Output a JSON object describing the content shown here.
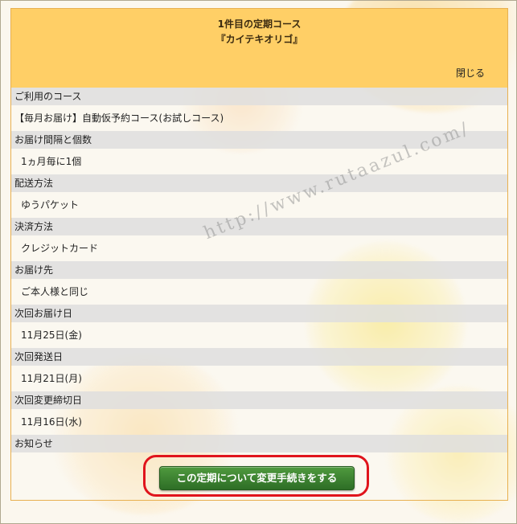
{
  "course": {
    "title_line1": "1件目の定期コース",
    "title_line2": "『カイテキオリゴ』",
    "close_label": "閉じる"
  },
  "watermark": "http://www.rutaazul.com/",
  "details": [
    {
      "label": "ご利用のコース",
      "value": "【毎月お届け】自動仮予約コース(お試しコース)"
    },
    {
      "label": "お届け間隔と個数",
      "value": "1ヵ月毎に1個"
    },
    {
      "label": "配送方法",
      "value": "ゆうパケット"
    },
    {
      "label": "決済方法",
      "value": "クレジットカード"
    },
    {
      "label": "お届け先",
      "value": "ご本人様と同じ"
    },
    {
      "label": "次回お届け日",
      "value": "11月25日(金)"
    },
    {
      "label": "次回発送日",
      "value": "11月21日(月)"
    },
    {
      "label": "次回変更締切日",
      "value": "11月16日(水)"
    },
    {
      "label": "お知らせ",
      "value": ""
    }
  ],
  "action": {
    "label": "この定期について変更手続きをする"
  },
  "colors": {
    "header": "#ffcf66",
    "label_row": "#dedede",
    "button": "#3d8431",
    "highlight": "#e0141c"
  }
}
